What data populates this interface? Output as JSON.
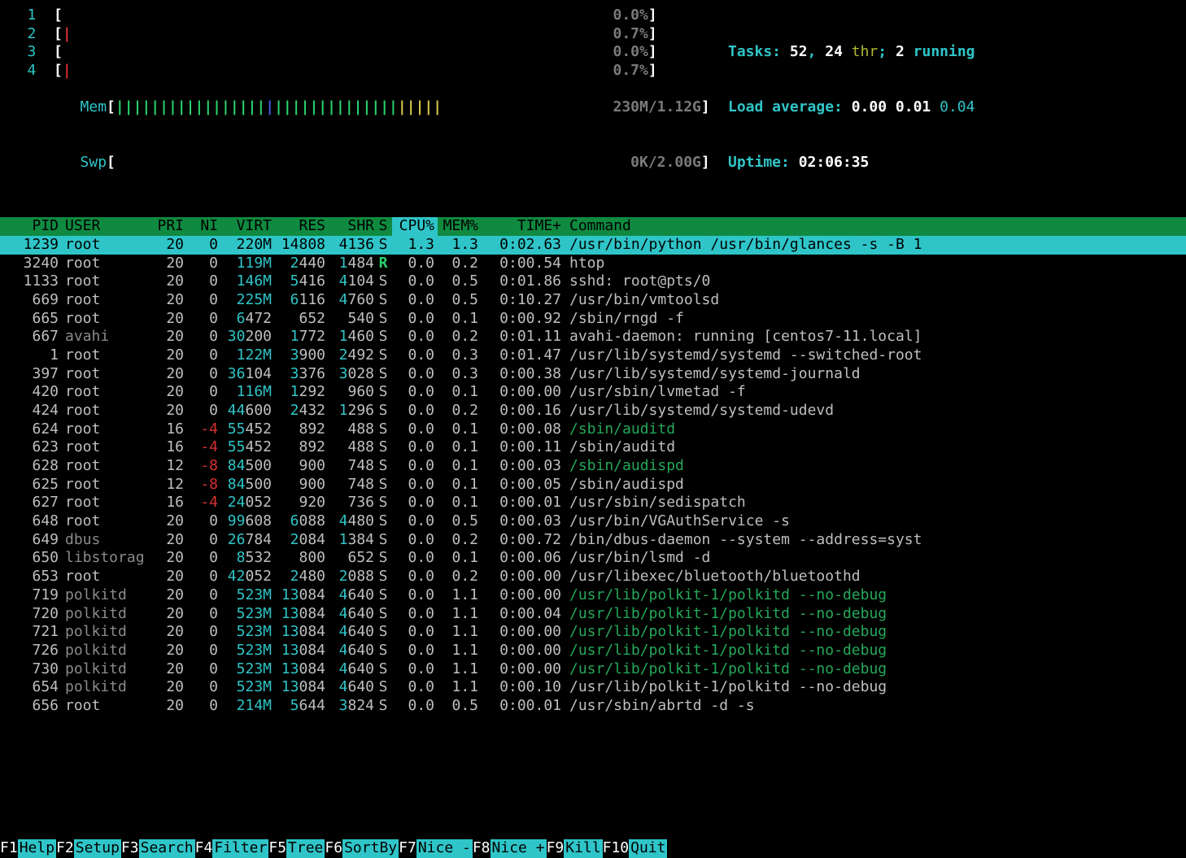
{
  "cpu_meters": [
    {
      "label": "1",
      "ticks": "",
      "value": "0.0%",
      "value_color": "greyDB"
    },
    {
      "label": "2",
      "ticks": "R",
      "value": "0.7%",
      "value_color": "greyDB"
    },
    {
      "label": "3",
      "ticks": "",
      "value": "0.0%",
      "value_color": "greyDB"
    },
    {
      "label": "4",
      "ticks": "R",
      "value": "0.7%",
      "value_color": "greyDB"
    }
  ],
  "mem": {
    "label": "Mem",
    "bar": "|||||||||||||||||B||||||||||||||YYYYY",
    "value": "230M/1.12G"
  },
  "swp": {
    "label": "Swp",
    "bar": "",
    "value": "0K/2.00G"
  },
  "summary": {
    "tasks_label": "Tasks: ",
    "tasks_n": "52",
    "tasks_sep": ", ",
    "threads_n": "24",
    "thr_label": " thr",
    "running_sep": "; ",
    "running_n": "2",
    "running_label": " running",
    "load_label": "Load average: ",
    "load1": "0.00",
    "load2": "0.01",
    "load3": "0.04",
    "uptime_label": "Uptime: ",
    "uptime": "02:06:35"
  },
  "columns": [
    "PID",
    "USER",
    "PRI",
    "NI",
    "VIRT",
    "RES",
    "SHR",
    "S",
    "CPU%",
    "MEM%",
    "TIME+",
    "Command"
  ],
  "sort_column": "CPU%",
  "rows": [
    {
      "pid": "1239",
      "user": "root",
      "pri": "20",
      "ni": "0",
      "virt": "220M",
      "res": "14808",
      "shr": "4136",
      "s": "S",
      "cpu": "1.3",
      "mem": "1.3",
      "time": "0:02.63",
      "cmd": "/usr/bin/python /usr/bin/glances -s -B 1",
      "selected": true
    },
    {
      "pid": "3240",
      "user": "root",
      "pri": "20",
      "ni": "0",
      "virt": "119M",
      "res": "2440",
      "shr": "1484",
      "s": "R",
      "cpu": "0.0",
      "mem": "0.2",
      "time": "0:00.54",
      "cmd": "htop",
      "s_color": "greenB"
    },
    {
      "pid": "1133",
      "user": "root",
      "pri": "20",
      "ni": "0",
      "virt": "146M",
      "res": "5416",
      "shr": "4104",
      "s": "S",
      "cpu": "0.0",
      "mem": "0.5",
      "time": "0:01.86",
      "cmd": "sshd: root@pts/0"
    },
    {
      "pid": "669",
      "user": "root",
      "pri": "20",
      "ni": "0",
      "virt": "225M",
      "res": "6116",
      "shr": "4760",
      "s": "S",
      "cpu": "0.0",
      "mem": "0.5",
      "time": "0:10.27",
      "cmd": "/usr/bin/vmtoolsd"
    },
    {
      "pid": "665",
      "user": "root",
      "pri": "20",
      "ni": "0",
      "virt": "6472",
      "res": "652",
      "shr": "540",
      "s": "S",
      "cpu": "0.0",
      "mem": "0.1",
      "time": "0:00.92",
      "cmd": "/sbin/rngd -f"
    },
    {
      "pid": "667",
      "user": "avahi",
      "user_dim": true,
      "pri": "20",
      "ni": "0",
      "virt": "30200",
      "res": "1772",
      "shr": "1460",
      "s": "S",
      "cpu": "0.0",
      "mem": "0.2",
      "time": "0:01.11",
      "cmd": "avahi-daemon: running [centos7-11.local]"
    },
    {
      "pid": "1",
      "user": "root",
      "pri": "20",
      "ni": "0",
      "virt": "122M",
      "res": "3900",
      "shr": "2492",
      "s": "S",
      "cpu": "0.0",
      "mem": "0.3",
      "time": "0:01.47",
      "cmd": "/usr/lib/systemd/systemd --switched-root"
    },
    {
      "pid": "397",
      "user": "root",
      "pri": "20",
      "ni": "0",
      "virt": "36104",
      "res": "3376",
      "shr": "3028",
      "s": "S",
      "cpu": "0.0",
      "mem": "0.3",
      "time": "0:00.38",
      "cmd": "/usr/lib/systemd/systemd-journald"
    },
    {
      "pid": "420",
      "user": "root",
      "pri": "20",
      "ni": "0",
      "virt": "116M",
      "res": "1292",
      "shr": "960",
      "s": "S",
      "cpu": "0.0",
      "mem": "0.1",
      "time": "0:00.00",
      "cmd": "/usr/sbin/lvmetad -f"
    },
    {
      "pid": "424",
      "user": "root",
      "pri": "20",
      "ni": "0",
      "virt": "44600",
      "res": "2432",
      "shr": "1296",
      "s": "S",
      "cpu": "0.0",
      "mem": "0.2",
      "time": "0:00.16",
      "cmd": "/usr/lib/systemd/systemd-udevd"
    },
    {
      "pid": "624",
      "user": "root",
      "pri": "16",
      "ni": "-4",
      "ni_red": true,
      "virt": "55452",
      "res": "892",
      "shr": "488",
      "s": "S",
      "cpu": "0.0",
      "mem": "0.1",
      "time": "0:00.08",
      "cmd": "/sbin/auditd",
      "cmd_dim": true
    },
    {
      "pid": "623",
      "user": "root",
      "pri": "16",
      "ni": "-4",
      "ni_red": true,
      "virt": "55452",
      "res": "892",
      "shr": "488",
      "s": "S",
      "cpu": "0.0",
      "mem": "0.1",
      "time": "0:00.11",
      "cmd": "/sbin/auditd"
    },
    {
      "pid": "628",
      "user": "root",
      "pri": "12",
      "ni": "-8",
      "ni_red": true,
      "virt": "84500",
      "res": "900",
      "shr": "748",
      "s": "S",
      "cpu": "0.0",
      "mem": "0.1",
      "time": "0:00.03",
      "cmd": "/sbin/audispd",
      "cmd_dim": true
    },
    {
      "pid": "625",
      "user": "root",
      "pri": "12",
      "ni": "-8",
      "ni_red": true,
      "virt": "84500",
      "res": "900",
      "shr": "748",
      "s": "S",
      "cpu": "0.0",
      "mem": "0.1",
      "time": "0:00.05",
      "cmd": "/sbin/audispd"
    },
    {
      "pid": "627",
      "user": "root",
      "pri": "16",
      "ni": "-4",
      "ni_red": true,
      "virt": "24052",
      "res": "920",
      "shr": "736",
      "s": "S",
      "cpu": "0.0",
      "mem": "0.1",
      "time": "0:00.01",
      "cmd": "/usr/sbin/sedispatch"
    },
    {
      "pid": "648",
      "user": "root",
      "pri": "20",
      "ni": "0",
      "virt": "99608",
      "res": "6088",
      "shr": "4480",
      "s": "S",
      "cpu": "0.0",
      "mem": "0.5",
      "time": "0:00.03",
      "cmd": "/usr/bin/VGAuthService -s"
    },
    {
      "pid": "649",
      "user": "dbus",
      "user_dim": true,
      "pri": "20",
      "ni": "0",
      "virt": "26784",
      "res": "2084",
      "shr": "1384",
      "s": "S",
      "cpu": "0.0",
      "mem": "0.2",
      "time": "0:00.72",
      "cmd": "/bin/dbus-daemon --system --address=syst"
    },
    {
      "pid": "650",
      "user": "libstorag",
      "user_dim": true,
      "pri": "20",
      "ni": "0",
      "virt": "8532",
      "res": "800",
      "shr": "652",
      "s": "S",
      "cpu": "0.0",
      "mem": "0.1",
      "time": "0:00.06",
      "cmd": "/usr/bin/lsmd -d"
    },
    {
      "pid": "653",
      "user": "root",
      "pri": "20",
      "ni": "0",
      "virt": "42052",
      "res": "2480",
      "shr": "2088",
      "s": "S",
      "cpu": "0.0",
      "mem": "0.2",
      "time": "0:00.00",
      "cmd": "/usr/libexec/bluetooth/bluetoothd"
    },
    {
      "pid": "719",
      "user": "polkitd",
      "user_dim": true,
      "pri": "20",
      "ni": "0",
      "virt": "523M",
      "res": "13084",
      "shr": "4640",
      "s": "S",
      "cpu": "0.0",
      "mem": "1.1",
      "time": "0:00.00",
      "cmd": "/usr/lib/polkit-1/polkitd --no-debug",
      "cmd_dim": true
    },
    {
      "pid": "720",
      "user": "polkitd",
      "user_dim": true,
      "pri": "20",
      "ni": "0",
      "virt": "523M",
      "res": "13084",
      "shr": "4640",
      "s": "S",
      "cpu": "0.0",
      "mem": "1.1",
      "time": "0:00.04",
      "cmd": "/usr/lib/polkit-1/polkitd --no-debug",
      "cmd_dim": true
    },
    {
      "pid": "721",
      "user": "polkitd",
      "user_dim": true,
      "pri": "20",
      "ni": "0",
      "virt": "523M",
      "res": "13084",
      "shr": "4640",
      "s": "S",
      "cpu": "0.0",
      "mem": "1.1",
      "time": "0:00.00",
      "cmd": "/usr/lib/polkit-1/polkitd --no-debug",
      "cmd_dim": true
    },
    {
      "pid": "726",
      "user": "polkitd",
      "user_dim": true,
      "pri": "20",
      "ni": "0",
      "virt": "523M",
      "res": "13084",
      "shr": "4640",
      "s": "S",
      "cpu": "0.0",
      "mem": "1.1",
      "time": "0:00.00",
      "cmd": "/usr/lib/polkit-1/polkitd --no-debug",
      "cmd_dim": true
    },
    {
      "pid": "730",
      "user": "polkitd",
      "user_dim": true,
      "pri": "20",
      "ni": "0",
      "virt": "523M",
      "res": "13084",
      "shr": "4640",
      "s": "S",
      "cpu": "0.0",
      "mem": "1.1",
      "time": "0:00.00",
      "cmd": "/usr/lib/polkit-1/polkitd --no-debug",
      "cmd_dim": true
    },
    {
      "pid": "654",
      "user": "polkitd",
      "user_dim": true,
      "pri": "20",
      "ni": "0",
      "virt": "523M",
      "res": "13084",
      "shr": "4640",
      "s": "S",
      "cpu": "0.0",
      "mem": "1.1",
      "time": "0:00.10",
      "cmd": "/usr/lib/polkit-1/polkitd --no-debug"
    },
    {
      "pid": "656",
      "user": "root",
      "pri": "20",
      "ni": "0",
      "virt": "214M",
      "res": "5644",
      "shr": "3824",
      "s": "S",
      "cpu": "0.0",
      "mem": "0.5",
      "time": "0:00.01",
      "cmd": "/usr/sbin/abrtd -d -s"
    }
  ],
  "fnkeys": [
    {
      "key": "F1",
      "label": "Help  "
    },
    {
      "key": "F2",
      "label": "Setup "
    },
    {
      "key": "F3",
      "label": "Search"
    },
    {
      "key": "F4",
      "label": "Filter"
    },
    {
      "key": "F5",
      "label": "Tree  "
    },
    {
      "key": "F6",
      "label": "SortBy"
    },
    {
      "key": "F7",
      "label": "Nice -"
    },
    {
      "key": "F8",
      "label": "Nice +"
    },
    {
      "key": "F9",
      "label": "Kill  "
    },
    {
      "key": "F10",
      "label": "Quit  "
    }
  ]
}
